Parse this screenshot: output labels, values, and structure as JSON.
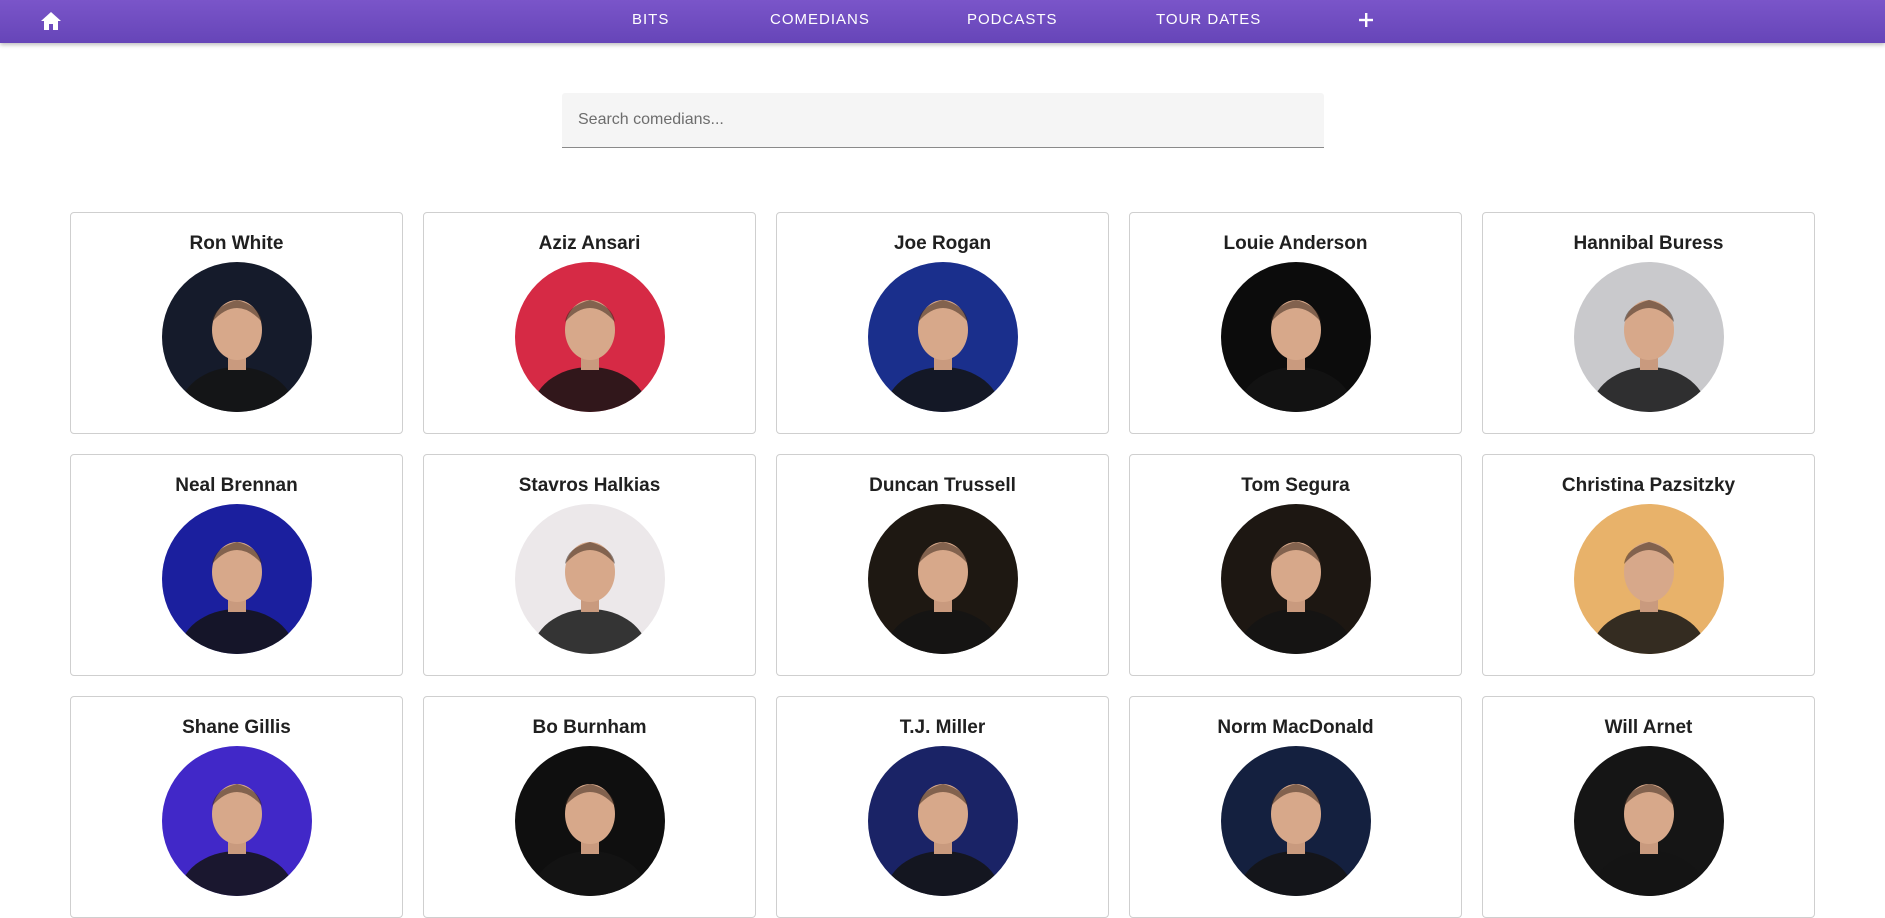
{
  "nav": {
    "items": [
      {
        "label": "BITS"
      },
      {
        "label": "COMEDIANS"
      },
      {
        "label": "PODCASTS"
      },
      {
        "label": "TOUR DATES"
      }
    ]
  },
  "search": {
    "placeholder": "Search comedians...",
    "value": ""
  },
  "comedians": [
    {
      "name": "Ron White",
      "bg": "#151b2b"
    },
    {
      "name": "Aziz Ansari",
      "bg": "#d62a45"
    },
    {
      "name": "Joe Rogan",
      "bg": "#1a2f8c"
    },
    {
      "name": "Louie Anderson",
      "bg": "#0c0c0c"
    },
    {
      "name": "Hannibal Buress",
      "bg": "#c9c9cc"
    },
    {
      "name": "Neal Brennan",
      "bg": "#1b1f9e"
    },
    {
      "name": "Stavros Halkias",
      "bg": "#ece8ea"
    },
    {
      "name": "Duncan Trussell",
      "bg": "#1e1812"
    },
    {
      "name": "Tom Segura",
      "bg": "#1d1712"
    },
    {
      "name": "Christina Pazsitzky",
      "bg": "#e8b26a"
    },
    {
      "name": "Shane Gillis",
      "bg": "#4128c8"
    },
    {
      "name": "Bo Burnham",
      "bg": "#0f0f0f"
    },
    {
      "name": "T.J. Miller",
      "bg": "#1a2366"
    },
    {
      "name": "Norm MacDonald",
      "bg": "#14203f"
    },
    {
      "name": "Will Arnet",
      "bg": "#151515"
    }
  ]
}
